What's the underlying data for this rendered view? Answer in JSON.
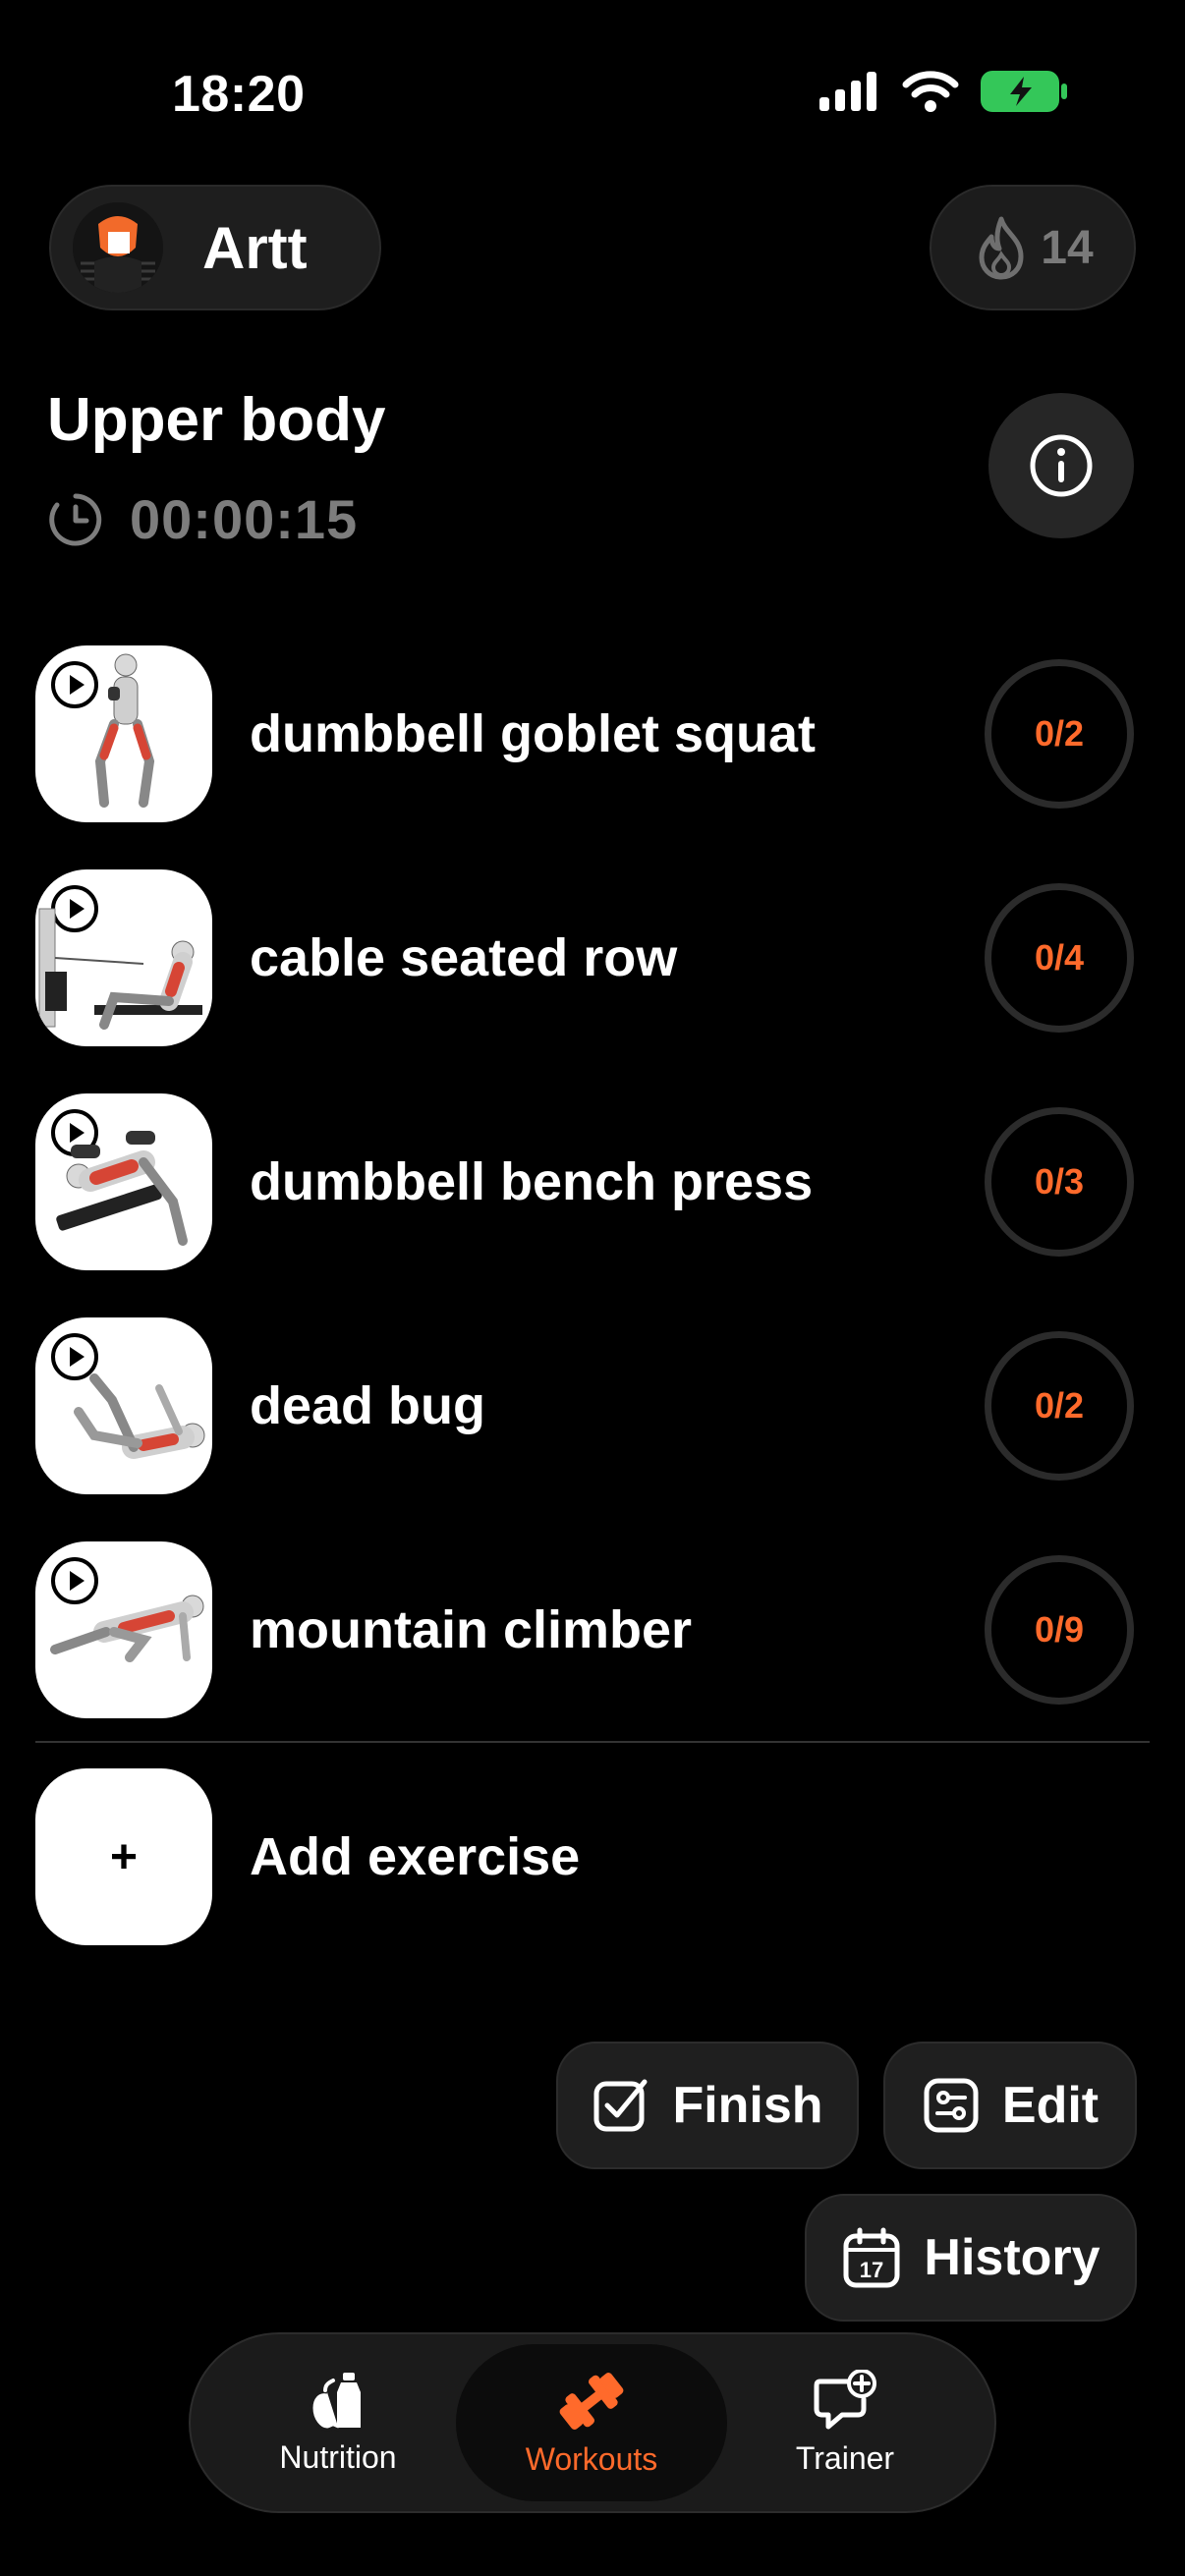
{
  "status_bar": {
    "time": "18:20"
  },
  "header": {
    "user_name": "Artt",
    "streak_count": "14"
  },
  "workout": {
    "title": "Upper body",
    "timer": "00:00:15"
  },
  "exercises": [
    {
      "name": "dumbbell goblet squat",
      "progress": "0/2"
    },
    {
      "name": "cable seated row",
      "progress": "0/4"
    },
    {
      "name": "dumbbell bench press",
      "progress": "0/3"
    },
    {
      "name": "dead bug",
      "progress": "0/2"
    },
    {
      "name": "mountain climber",
      "progress": "0/9"
    }
  ],
  "add_exercise": {
    "icon": "+",
    "label": "Add exercise"
  },
  "actions": {
    "finish": "Finish",
    "edit": "Edit",
    "history": "History",
    "history_calendar_day": "17"
  },
  "nav": {
    "items": [
      {
        "label": "Nutrition",
        "icon": "apple-bottle-icon"
      },
      {
        "label": "Workouts",
        "icon": "dumbbell-icon",
        "active": true
      },
      {
        "label": "Trainer",
        "icon": "chat-plus-icon"
      }
    ]
  },
  "colors": {
    "accent": "#ff6a2b",
    "battery": "#34c759",
    "background": "#000000"
  }
}
